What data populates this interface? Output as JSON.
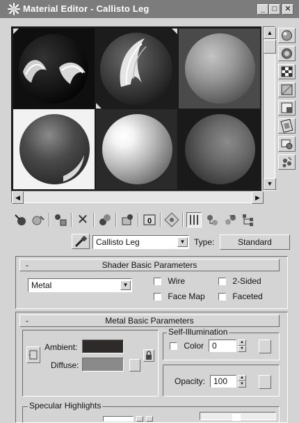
{
  "window": {
    "title": "Material Editor - Callisto Leg",
    "minimize_glyph": "_",
    "restore_glyph": "□",
    "close_glyph": "✕"
  },
  "toolbar": {
    "material_name": "Callisto Leg",
    "type_label": "Type:",
    "type_value": "Standard"
  },
  "shader_basic": {
    "header": "Shader Basic Parameters",
    "shader": "Metal",
    "wire": "Wire",
    "two_sided": "2-Sided",
    "face_map": "Face Map",
    "faceted": "Faceted"
  },
  "metal_basic": {
    "header": "Metal Basic Parameters",
    "ambient": "Ambient:",
    "diffuse": "Diffuse:",
    "self_illum_group": "Self-Illumination",
    "color_label": "Color",
    "color_value": "0",
    "opacity_label": "Opacity:",
    "opacity_value": "100",
    "ambient_color": "#2e2a2a",
    "diffuse_color": "#8a8a8a"
  },
  "specular": {
    "group": "Specular Highlights"
  },
  "rollout_minus": "-"
}
